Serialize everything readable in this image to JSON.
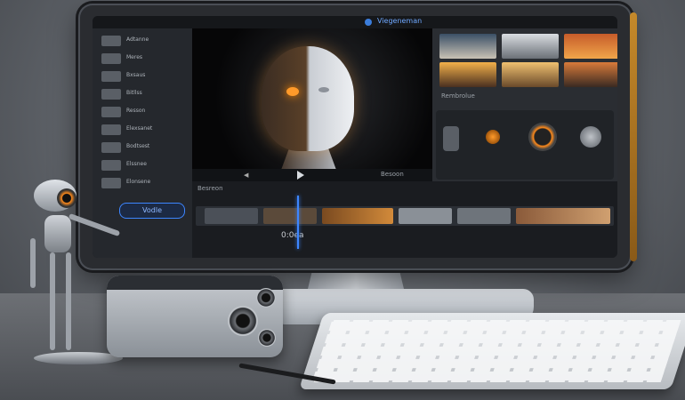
{
  "scene": {
    "description_items": [
      "monitor",
      "video-editor-ui",
      "robot-figure",
      "webcam",
      "keyboard",
      "pen"
    ]
  },
  "editor": {
    "app_title": "Viegeneman",
    "sidebar": {
      "items": [
        {
          "label": "Adtanne"
        },
        {
          "label": "Meres"
        },
        {
          "label": "Bxsaus"
        },
        {
          "label": "Bitllss"
        },
        {
          "label": "Resson"
        },
        {
          "label": "Elexsanet"
        },
        {
          "label": "Bodtsest"
        },
        {
          "label": "Elssnee"
        },
        {
          "label": "Elonsene"
        }
      ],
      "button_label": "Vodle"
    },
    "preview": {
      "label": "Besoon"
    },
    "right_panel": {
      "label": "Rembrolue"
    },
    "timeline": {
      "label": "Besreon",
      "time_display": "0:0ea"
    }
  },
  "colors": {
    "accent": "#3d86ff",
    "orange_glow": "#ff8a1a",
    "monitor_edge": "#c5892a"
  }
}
